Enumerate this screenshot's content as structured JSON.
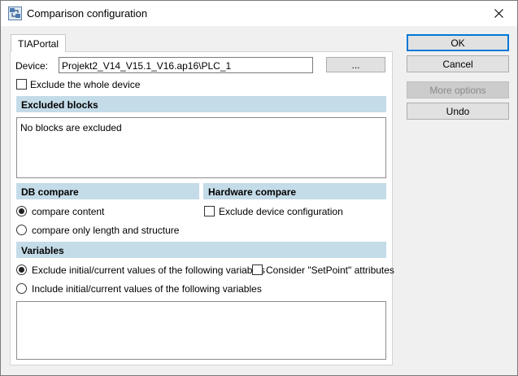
{
  "window": {
    "title": "Comparison configuration"
  },
  "tabs": [
    {
      "label": "TIAPortal"
    }
  ],
  "device": {
    "label": "Device:",
    "value": "Projekt2_V14_V15.1_V16.ap16\\PLC_1",
    "browse_label": "..."
  },
  "exclude_device": {
    "label": "Exclude the whole device",
    "checked": false
  },
  "excluded_blocks": {
    "header": "Excluded blocks",
    "empty_text": "No blocks are excluded"
  },
  "db_compare": {
    "header": "DB compare",
    "options": [
      {
        "label": "compare content",
        "selected": true
      },
      {
        "label": "compare only length and structure",
        "selected": false
      }
    ]
  },
  "hardware_compare": {
    "header": "Hardware compare",
    "exclude_config_label": "Exclude device configuration",
    "checked": false
  },
  "variables": {
    "header": "Variables",
    "exclude_label": "Exclude initial/current values of the following variables",
    "include_label": "Include initial/current values of the following variables",
    "selected": "exclude",
    "setpoint_label": "Consider \"SetPoint\" attributes",
    "setpoint_checked": false
  },
  "buttons": {
    "ok": "OK",
    "cancel": "Cancel",
    "more_options": "More options",
    "undo": "Undo"
  }
}
